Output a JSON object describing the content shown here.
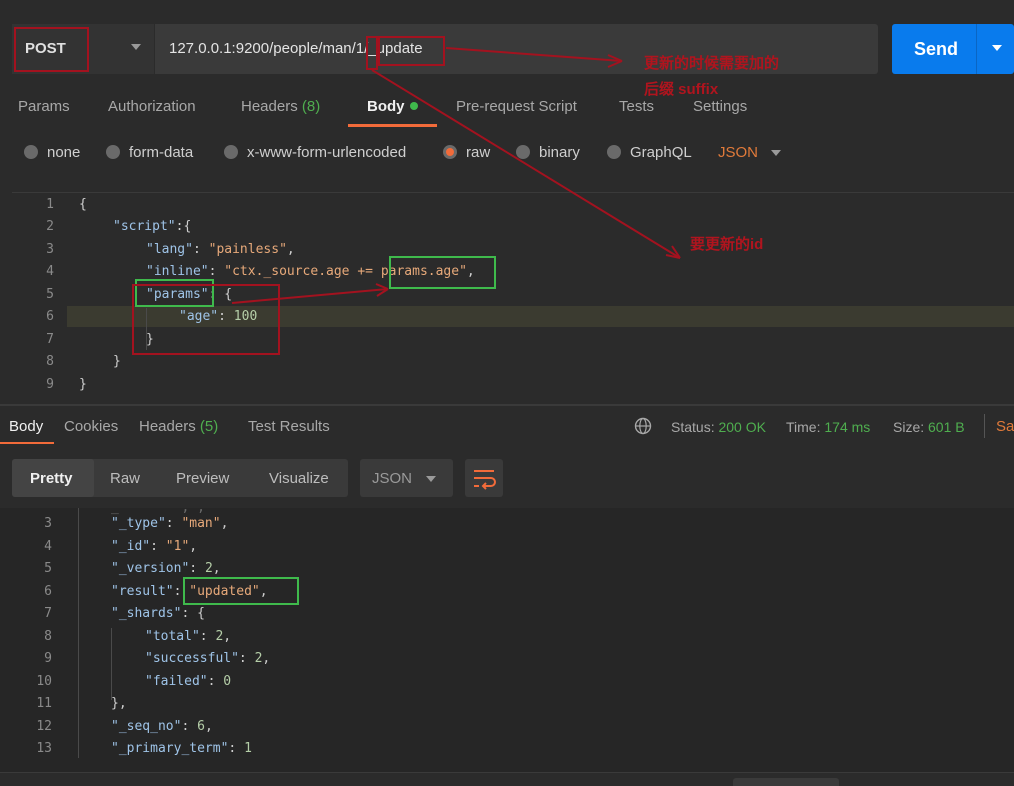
{
  "request": {
    "method": "POST",
    "url": "127.0.0.1:9200/people/man/1/_update",
    "send_label": "Send"
  },
  "request_tabs": [
    {
      "label": "Params"
    },
    {
      "label": "Authorization"
    },
    {
      "label": "Headers",
      "count": "(8)"
    },
    {
      "label": "Body",
      "active": true
    },
    {
      "label": "Pre-request Script"
    },
    {
      "label": "Tests"
    },
    {
      "label": "Settings"
    }
  ],
  "body_types": [
    "none",
    "form-data",
    "x-www-form-urlencoded",
    "raw",
    "binary",
    "GraphQL"
  ],
  "body_format": "JSON",
  "request_body_lines": [
    "{",
    "\"script\":{",
    "\"lang\": \"painless\",",
    "\"inline\": \"ctx._source.age += params.age\",",
    "\"params\": {",
    "\"age\": 100",
    "}",
    "}",
    "}"
  ],
  "annotations": {
    "url_note_line1": "更新的时候需要加的",
    "url_note_line2": "后缀 suffix",
    "id_note": "要更新的id"
  },
  "response_tabs": [
    {
      "label": "Body",
      "active": true
    },
    {
      "label": "Cookies"
    },
    {
      "label": "Headers",
      "count": "(5)"
    },
    {
      "label": "Test Results"
    }
  ],
  "response_meta": {
    "status_label": "Status:",
    "status_value": "200 OK",
    "time_label": "Time:",
    "time_value": "174 ms",
    "size_label": "Size:",
    "size_value": "601 B",
    "save_partial": "Sa"
  },
  "response_view": {
    "modes": [
      "Pretty",
      "Raw",
      "Preview",
      "Visualize"
    ],
    "format": "JSON"
  },
  "response_lines": [
    {
      "n": "3",
      "text": "\"_type\": \"man\","
    },
    {
      "n": "4",
      "text": "\"_id\": \"1\","
    },
    {
      "n": "5",
      "text": "\"_version\": 2,"
    },
    {
      "n": "6",
      "text": "\"result\": \"updated\","
    },
    {
      "n": "7",
      "text": "\"_shards\": {"
    },
    {
      "n": "8",
      "text": "\"total\": 2,"
    },
    {
      "n": "9",
      "text": "\"successful\": 2,"
    },
    {
      "n": "10",
      "text": "\"failed\": 0"
    },
    {
      "n": "11",
      "text": "},"
    },
    {
      "n": "12",
      "text": "\"_seq_no\": 6,"
    },
    {
      "n": "13",
      "text": "\"_primary_term\": 1"
    }
  ],
  "colors": {
    "accent": "#f26b3a",
    "send": "#097bed",
    "success": "#4fae4f",
    "annotation_red": "#a3121f",
    "annotation_green": "#3fba4c"
  }
}
